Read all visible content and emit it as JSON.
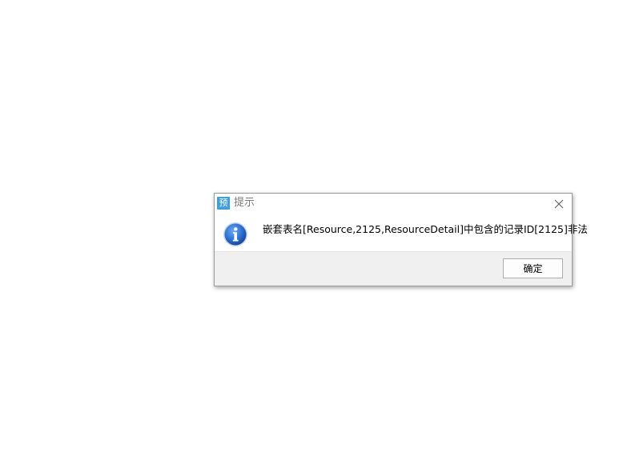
{
  "dialog": {
    "title": "提示",
    "app_icon_glyph": "预",
    "message": "嵌套表名[Resource,2125,ResourceDetail]中包含的记录ID[2125]非法",
    "ok_label": "确定",
    "icons": {
      "app": "app-icon",
      "info": "info-icon",
      "close": "close-icon"
    },
    "colors": {
      "app_icon_bg": "#3f9fd8",
      "info_icon": "#1f5fbf",
      "footer_bg": "#f0f0f0"
    }
  }
}
